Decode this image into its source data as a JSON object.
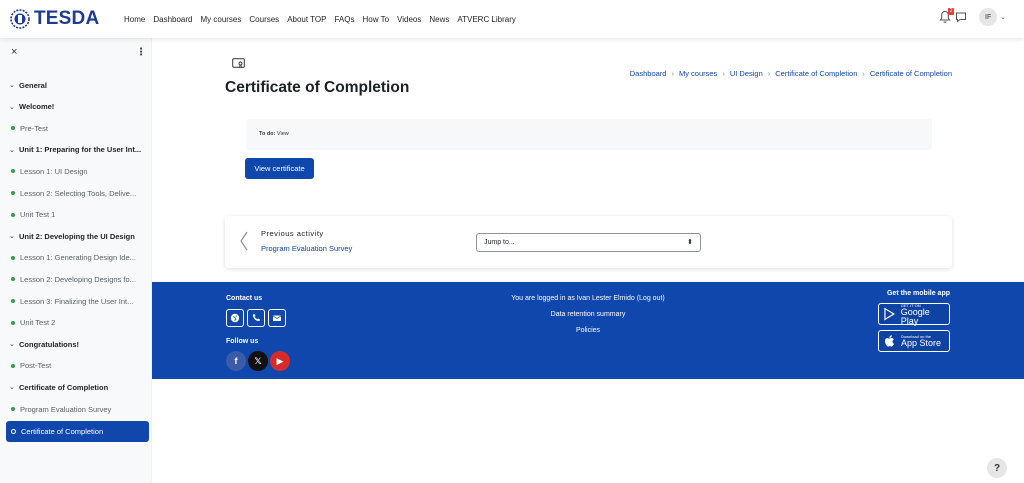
{
  "brand": {
    "name": "TESDA"
  },
  "nav": {
    "links": [
      "Home",
      "Dashboard",
      "My courses",
      "Courses",
      "About TOP",
      "FAQs",
      "How To",
      "Videos",
      "News",
      "ATVERC Library"
    ],
    "notification_count": "2",
    "user_initials": "IF"
  },
  "drawer": {
    "close_glyph": "×",
    "more_glyph": "⋮",
    "items": [
      {
        "type": "section",
        "label": "General"
      },
      {
        "type": "section",
        "label": "Welcome!"
      },
      {
        "type": "activity",
        "label": "Pre-Test"
      },
      {
        "type": "section",
        "label": "Unit 1: Preparing for the User Int..."
      },
      {
        "type": "activity",
        "label": "Lesson 1: UI Design"
      },
      {
        "type": "activity",
        "label": "Lesson 2: Selecting Tools, Delive..."
      },
      {
        "type": "activity",
        "label": "Unit Test 1"
      },
      {
        "type": "section",
        "label": "Unit 2: Developing the UI Design"
      },
      {
        "type": "activity",
        "label": "Lesson 1: Generating Design Ide..."
      },
      {
        "type": "activity",
        "label": "Lesson 2: Developing Designs fo..."
      },
      {
        "type": "activity",
        "label": "Lesson 3: Finalizing the User Int..."
      },
      {
        "type": "activity",
        "label": "Unit Test 2"
      },
      {
        "type": "section",
        "label": "Congratulations!"
      },
      {
        "type": "activity",
        "label": "Post-Test"
      },
      {
        "type": "section",
        "label": "Certificate of Completion"
      },
      {
        "type": "activity",
        "label": "Program Evaluation Survey"
      },
      {
        "type": "current",
        "label": "Certificate of Completion"
      }
    ]
  },
  "page": {
    "title": "Certificate of Completion",
    "breadcrumb": [
      "Dashboard",
      "My courses",
      "UI Design",
      "Certificate of Completion",
      "Certificate of Completion"
    ],
    "todo_label": "To do:",
    "todo_value": "View",
    "view_button": "View certificate"
  },
  "activity_nav": {
    "previous_label": "Previous activity",
    "previous_link": "Program Evaluation Survey",
    "jump_placeholder": "Jump to..."
  },
  "footer": {
    "contact_title": "Contact us",
    "follow_title": "Follow us",
    "logged_in_text": "You are logged in as Ivan Lester Elmido (Log out)",
    "data_retention": "Data retention summary",
    "policies": "Policies",
    "mobile_title": "Get the mobile app",
    "google_small": "GET IT ON",
    "google_big": "Google Play",
    "apple_small": "Download on the",
    "apple_big": "App Store",
    "social": [
      "f",
      "𝕏",
      "▶"
    ]
  },
  "help_glyph": "?",
  "colors": {
    "primary": "#0f47ad",
    "brand": "#1f3a93",
    "complete": "#2f9e44"
  }
}
